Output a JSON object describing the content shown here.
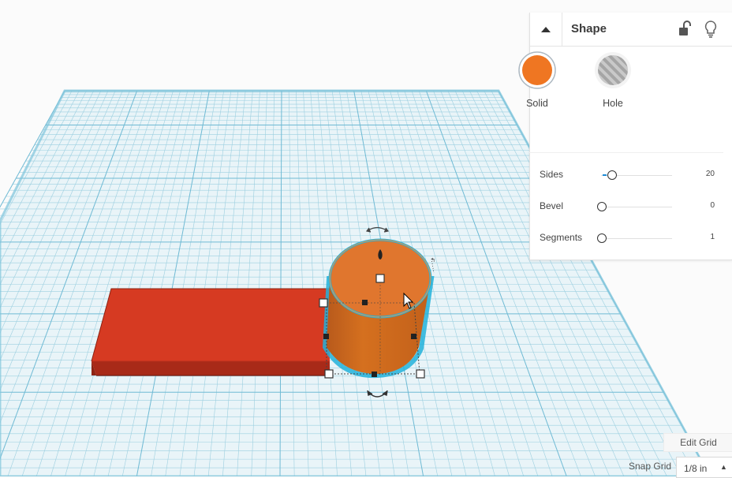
{
  "inspector": {
    "title": "Shape",
    "solid_label": "Solid",
    "hole_label": "Hole",
    "properties": [
      {
        "name": "Sides",
        "value": "20"
      },
      {
        "name": "Bevel",
        "value": "0"
      },
      {
        "name": "Segments",
        "value": "1"
      }
    ]
  },
  "grid": {
    "edit_label": "Edit Grid",
    "snap_label": "Snap Grid",
    "snap_value": "1/8 in"
  },
  "icons": {
    "collapse": "caret-up-icon",
    "lock": "unlock-icon",
    "light": "lightbulb-icon"
  },
  "colors": {
    "solid_swatch": "#ef7622",
    "box_shape": "#d63a22",
    "cylinder_shape": "#e0762e",
    "workplane_grid": "#7fc4db",
    "selection_outline": "#22b1da"
  }
}
